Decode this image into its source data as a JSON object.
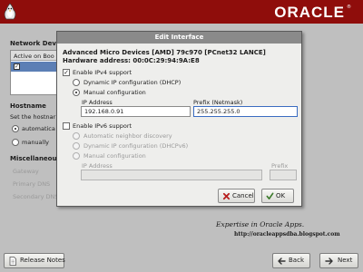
{
  "banner": {
    "brand": "ORACLE",
    "reg_mark": "®"
  },
  "background": {
    "network_devices_heading": "Network Devic",
    "network_devices_header": "Active on Boo",
    "hostname_heading": "Hostname",
    "hostname_prompt": "Set the hostnar",
    "hostname_automatic": "automatica",
    "hostname_manually": "manually",
    "misc_heading": "Miscellaneous",
    "gateway_label": "Gateway",
    "primary_dns_label": "Primary DNS",
    "secondary_dns_label": "Secondary DNS"
  },
  "dialog": {
    "title": "Edit Interface",
    "device": "Advanced Micro Devices [AMD] 79c970 [PCnet32 LANCE]",
    "hardware_address": "Hardware address: 00:0C:29:94:9A:E8",
    "ipv4": {
      "enable_label": "Enable IPv4 support",
      "enabled": true,
      "dhcp_label": "Dynamic IP configuration (DHCP)",
      "manual_label": "Manual configuration",
      "selected": "manual",
      "ip_address_label": "IP Address",
      "ip_address_value": "192.168.0.91",
      "prefix_label": "Prefix (Netmask)",
      "prefix_value": "255.255.255.0"
    },
    "ipv6": {
      "enable_label": "Enable IPv6 support",
      "enabled": false,
      "auto_label": "Automatic neighbor discovery",
      "dhcp_label": "Dynamic IP configuration (DHCPv6)",
      "manual_label": "Manual configuration",
      "ip_address_label": "IP Address",
      "prefix_label": "Prefix",
      "ip_address_value": "",
      "prefix_value": ""
    },
    "cancel_label": "Cancel",
    "ok_label": "OK"
  },
  "watermark": {
    "line1": "Expertise in Oracle Apps.",
    "line2": "http://oracleappsdba.blogspot.com"
  },
  "nav": {
    "release_notes_label": "Release Notes",
    "back_label": "Back",
    "next_label": "Next"
  },
  "colors": {
    "banner": "#8f0d0b",
    "background": "#bfbfbf",
    "dialog_title": "#8a8a8a",
    "selection": "#5c7fb5"
  }
}
